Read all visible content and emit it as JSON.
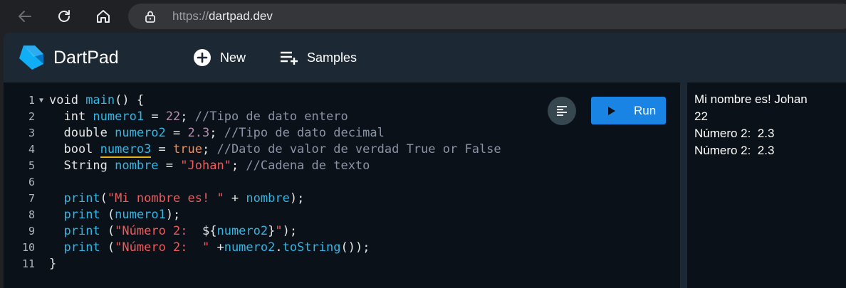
{
  "browser": {
    "url_protocol": "https://",
    "url_host": "dartpad.dev"
  },
  "app": {
    "brand": "DartPad",
    "toolbar": {
      "new_label": "New",
      "samples_label": "Samples"
    },
    "run_label": "Run"
  },
  "editor": {
    "line_numbers": [
      "1",
      "2",
      "3",
      "4",
      "5",
      "6",
      "7",
      "8",
      "9",
      "10",
      "11"
    ],
    "tokens": {
      "l1": [
        "void ",
        "main",
        "() {"
      ],
      "l2": [
        "  int ",
        "numero1",
        " = ",
        "22",
        "; ",
        "//Tipo de dato entero"
      ],
      "l3": [
        "  double ",
        "numero2",
        " = ",
        "2.3",
        "; ",
        "//Tipo de dato decimal"
      ],
      "l4": [
        "  bool ",
        "numero3",
        " = ",
        "true",
        "; ",
        "//Dato de valor de verdad True or False"
      ],
      "l5": [
        "  String ",
        "nombre",
        " = ",
        "\"Johan\"",
        "; ",
        "//Cadena de texto"
      ],
      "l7": [
        "  ",
        "print",
        "(",
        "\"Mi nombre es! \"",
        " + ",
        "nombre",
        ");"
      ],
      "l8": [
        "  ",
        "print",
        " (",
        "numero1",
        ");"
      ],
      "l9": [
        "  ",
        "print",
        " (",
        "\"Número 2:  ",
        "${",
        "numero2",
        "}",
        "\"",
        ");"
      ],
      "l10": [
        "  ",
        "print",
        " (",
        "\"Número 2:  \"",
        " +",
        "numero2",
        ".",
        "toString",
        "());"
      ],
      "l11": [
        "}"
      ]
    }
  },
  "console": {
    "lines": [
      "Mi nombre es! Johan",
      "22",
      "Número 2:  2.3",
      "Número 2:  2.3"
    ]
  },
  "colors": {
    "accent": "#1a84e5",
    "editor_bg": "#0b1118",
    "header_bg": "#1c2834"
  }
}
